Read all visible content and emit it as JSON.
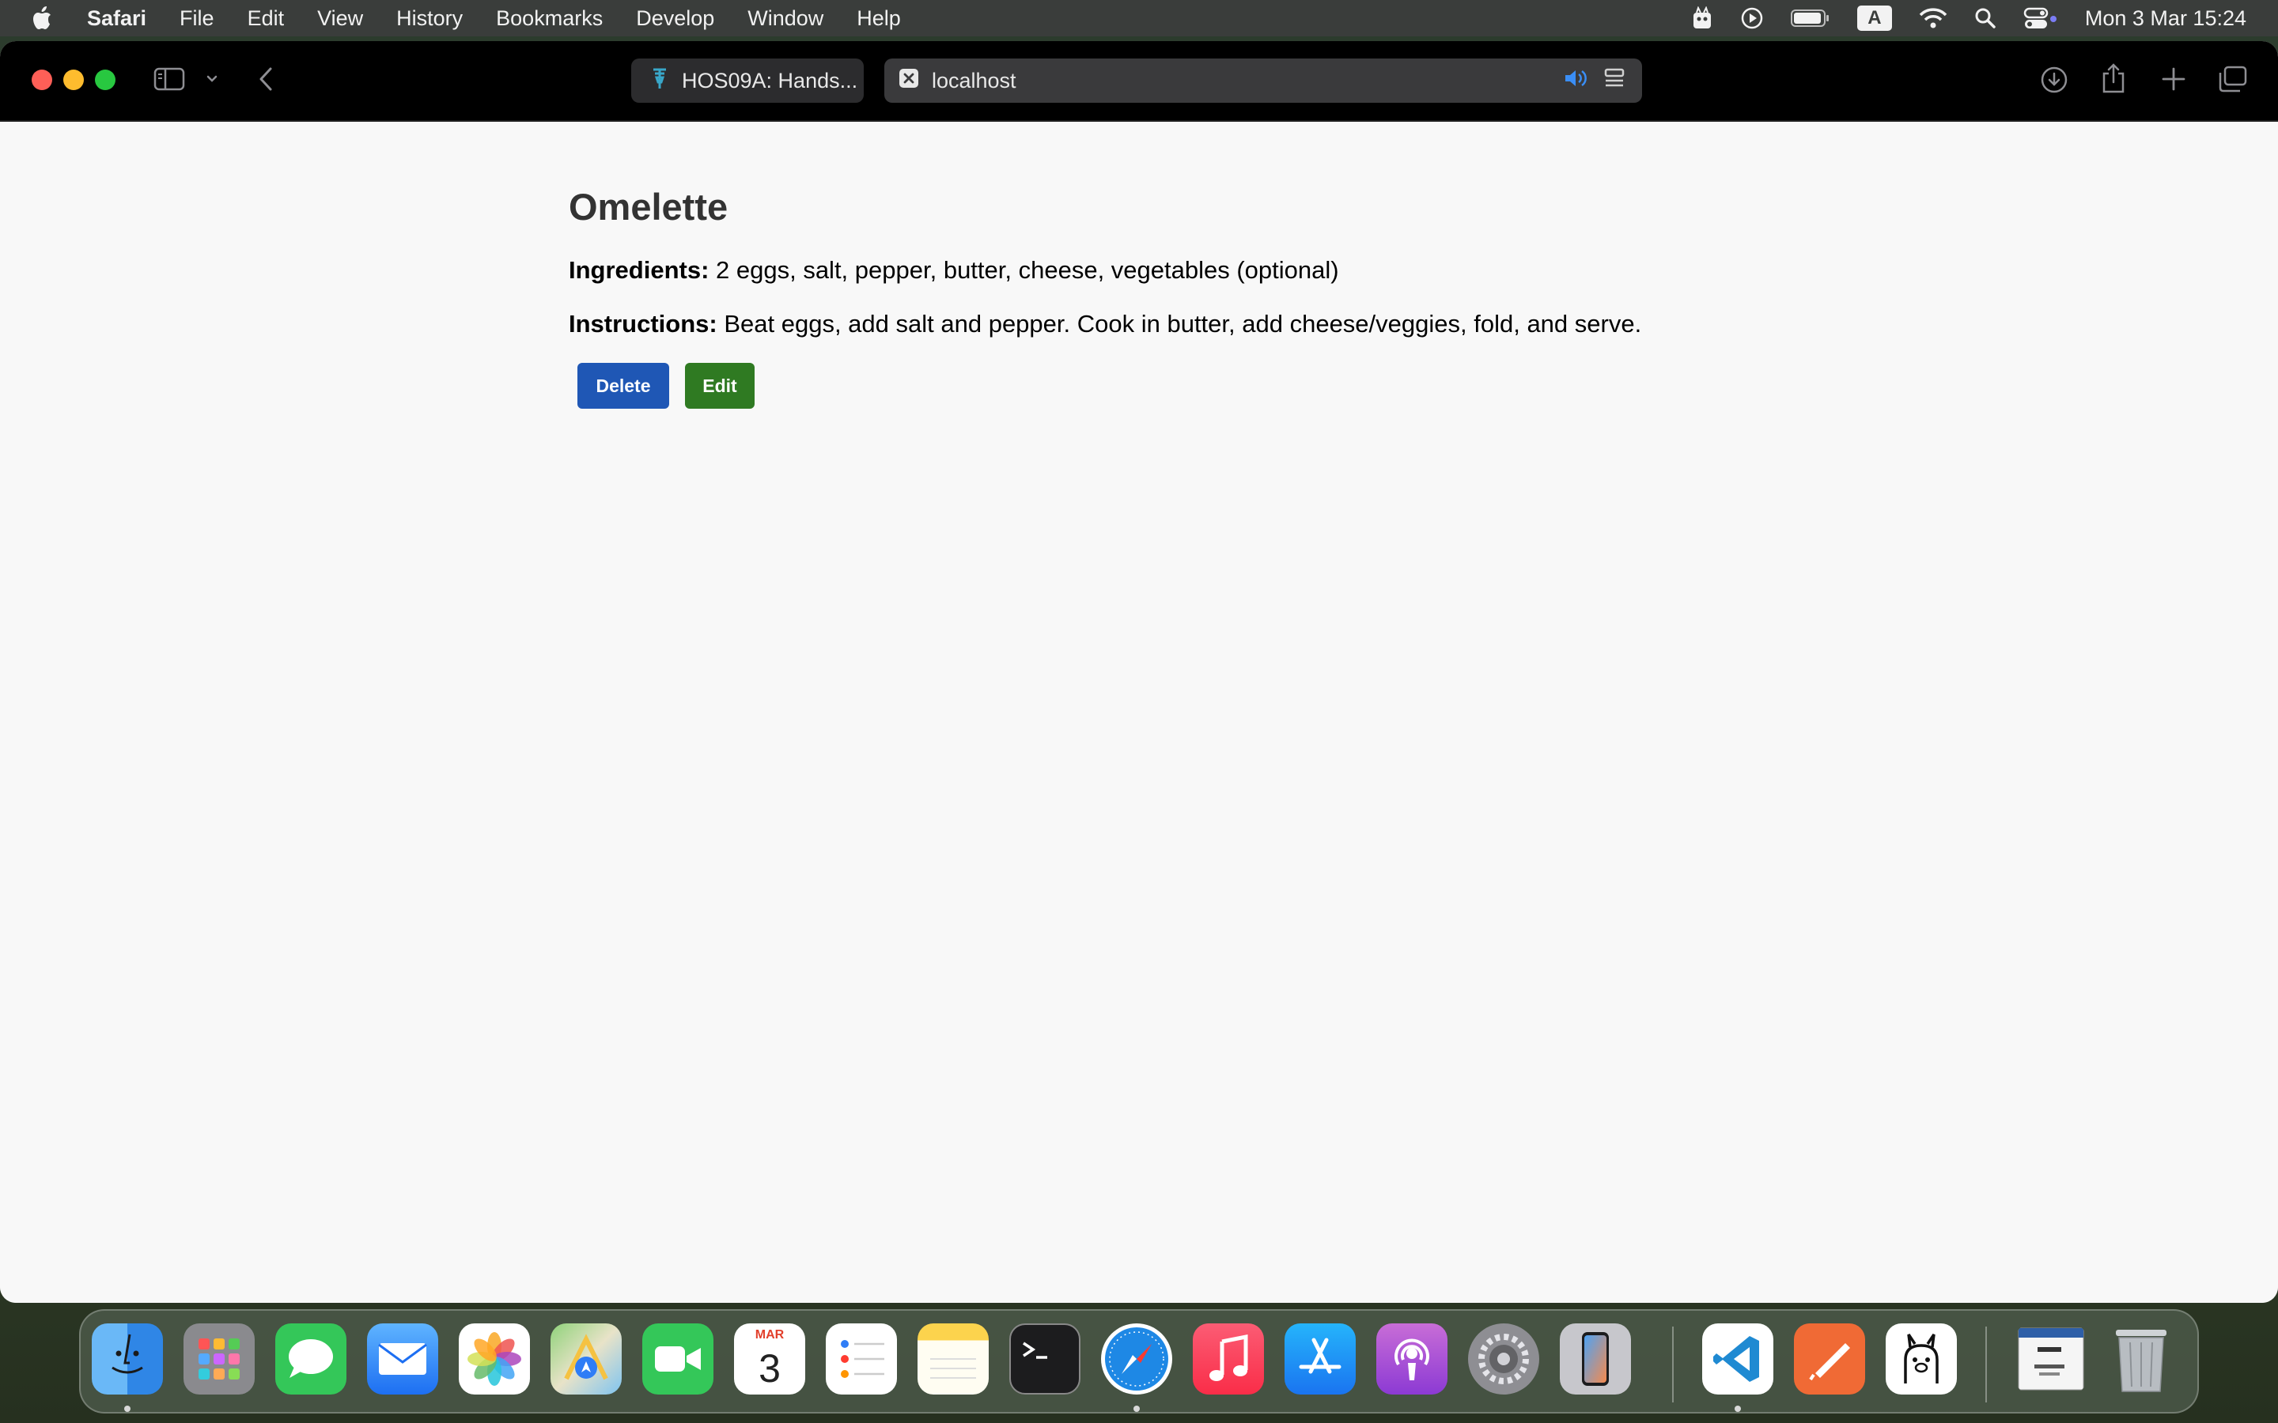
{
  "menubar": {
    "app_name": "Safari",
    "items": [
      "File",
      "Edit",
      "View",
      "History",
      "Bookmarks",
      "Develop",
      "Window",
      "Help"
    ],
    "input_source": "A",
    "clock": "Mon 3 Mar  15:24"
  },
  "browser": {
    "tabs": [
      {
        "title": "HOS09A: Hands...",
        "icon": "site-favicon-icon"
      },
      {
        "title": "localhost",
        "icon": "close-tab-icon"
      }
    ]
  },
  "recipe": {
    "title": "Omelette",
    "ingredients_label": "Ingredients:",
    "ingredients": " 2 eggs, salt, pepper, butter, cheese, vegetables (optional)",
    "instructions_label": "Instructions:",
    "instructions": " Beat eggs, add salt and pepper. Cook in butter, add cheese/veggies, fold, and serve.",
    "delete_label": "Delete",
    "edit_label": "Edit"
  },
  "dock": {
    "calendar_month": "MAR",
    "calendar_day": "3",
    "apps": [
      "Finder",
      "Launchpad",
      "Messages",
      "Mail",
      "Photos",
      "Maps",
      "FaceTime",
      "Calendar",
      "Reminders",
      "Notes",
      "Terminal",
      "Safari",
      "Music",
      "App Store",
      "Podcasts",
      "System Settings",
      "iPhone Mirroring",
      "Visual Studio Code",
      "Postman",
      "Ollama",
      "Document",
      "Trash"
    ]
  },
  "colors": {
    "delete_button": "#1f57b5",
    "edit_button": "#2f7a22",
    "toolbar": "#000000",
    "page_background": "#f8f8f8"
  }
}
